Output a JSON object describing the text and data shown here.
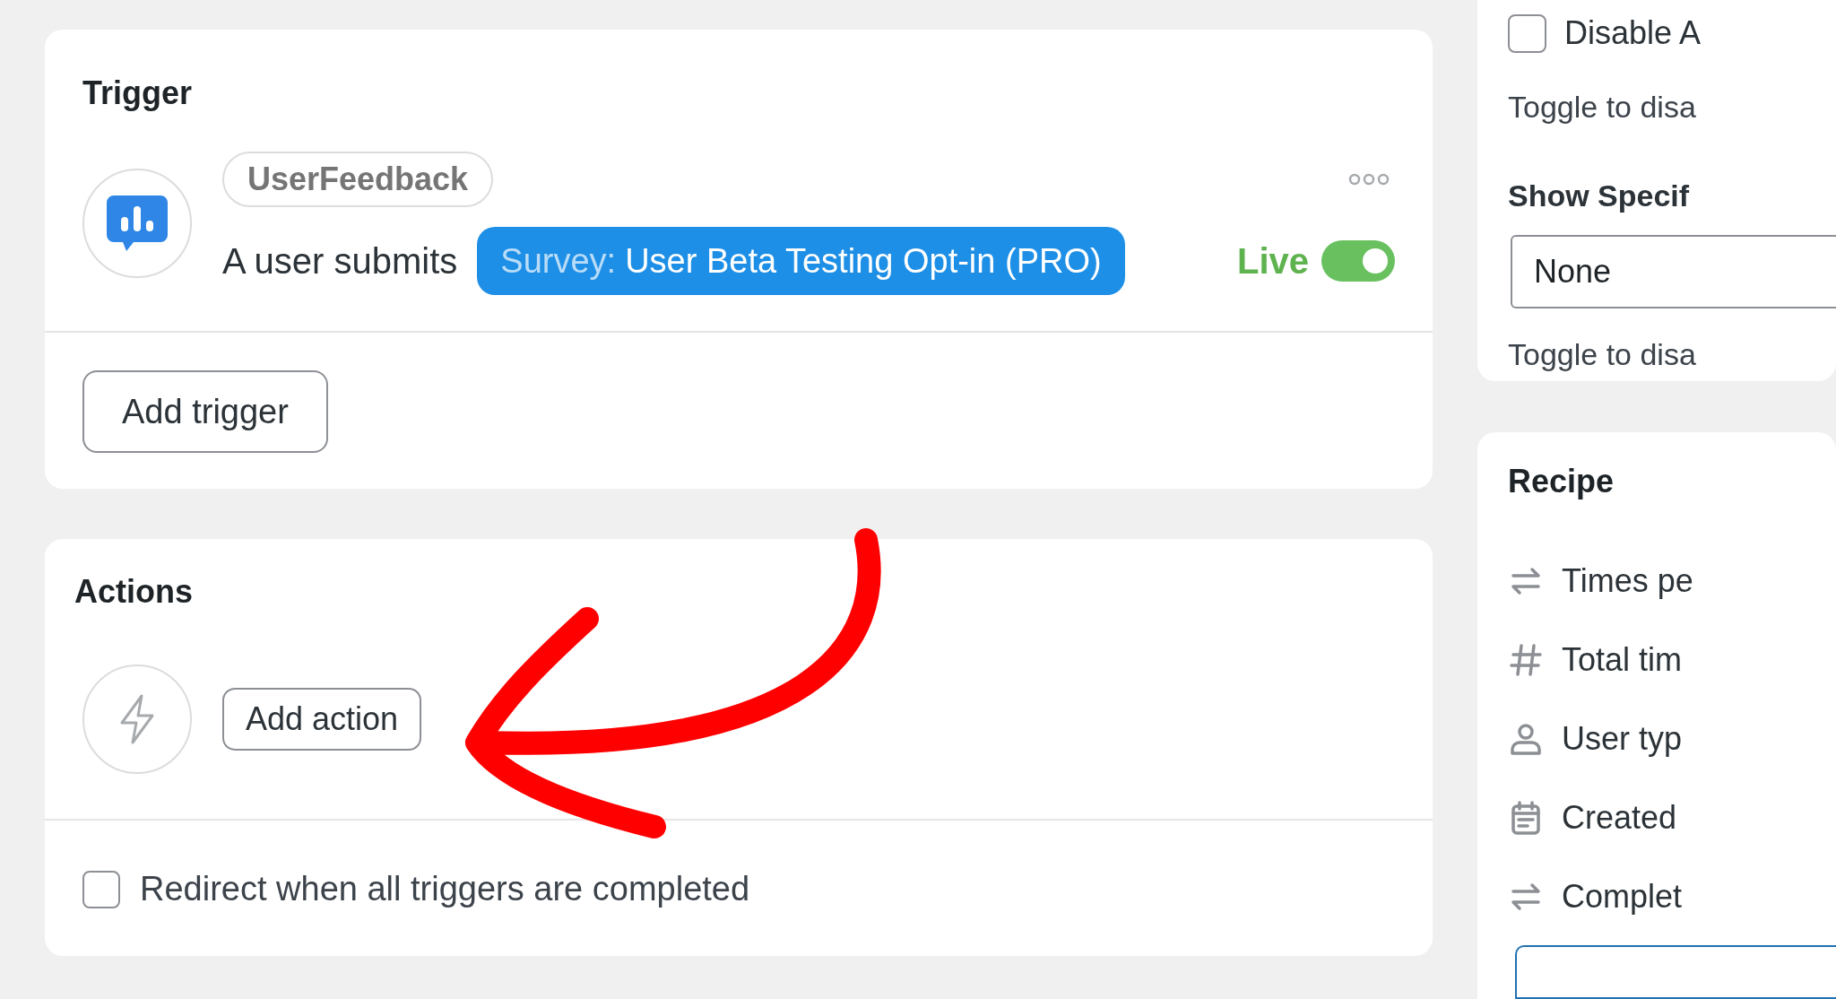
{
  "trigger_card": {
    "title": "Trigger",
    "integration": "UserFeedback",
    "sentence": "A user submits",
    "token": {
      "label": "Survey:",
      "value": "User Beta Testing Opt-in (PRO)"
    },
    "status": "Live",
    "live": {
      "on": true
    },
    "add_button": "Add trigger"
  },
  "actions_card": {
    "title": "Actions",
    "add_button": "Add action",
    "redirect": {
      "label": "Redirect when all triggers are completed",
      "checked": false
    }
  },
  "settings_card": {
    "disable": {
      "label": "Disable A",
      "checked": false
    },
    "disable_help": "Toggle to disa",
    "show_label": "Show Specif",
    "select_value": "None",
    "select_help": "Toggle to disa"
  },
  "recipe_card": {
    "title": "Recipe",
    "rows": [
      {
        "kind": "repeat",
        "label": "Times pe"
      },
      {
        "kind": "hash",
        "label": "Total tim"
      },
      {
        "kind": "user",
        "label": "User typ"
      },
      {
        "kind": "calendar",
        "label": "Created"
      },
      {
        "kind": "repeat",
        "label": "Complet"
      }
    ]
  }
}
